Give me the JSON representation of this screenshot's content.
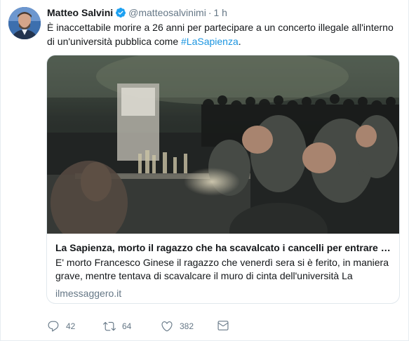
{
  "tweet": {
    "author_name": "Matteo Salvini",
    "handle": "@matteosalvinimi",
    "separator": "·",
    "time": "1 h",
    "text_main": "È inaccettabile morire a 26 anni per partecipare a un concerto illegale all'interno di un'università pubblica come ",
    "hashtag": "#LaSapienza",
    "text_end": "."
  },
  "card": {
    "title": "La Sapienza, morto il ragazzo che ha scavalcato i cancelli per entrare a un concerto",
    "description": "E' morto Francesco Ginese il ragazzo che venerdì sera si è ferito, in maniera grave, mentre tentava di scavalcare il muro di cinta dell'università La",
    "domain": "ilmessaggero.it"
  },
  "actions": {
    "replies": "42",
    "retweets": "64",
    "likes": "382"
  },
  "icons": {
    "reply": "reply-icon",
    "retweet": "retweet-icon",
    "like": "heart-icon",
    "dm": "envelope-icon",
    "verified": "verified-badge-icon"
  },
  "colors": {
    "accent": "#1b95e0",
    "secondary_text": "#657786",
    "border": "#e1e8ed"
  }
}
